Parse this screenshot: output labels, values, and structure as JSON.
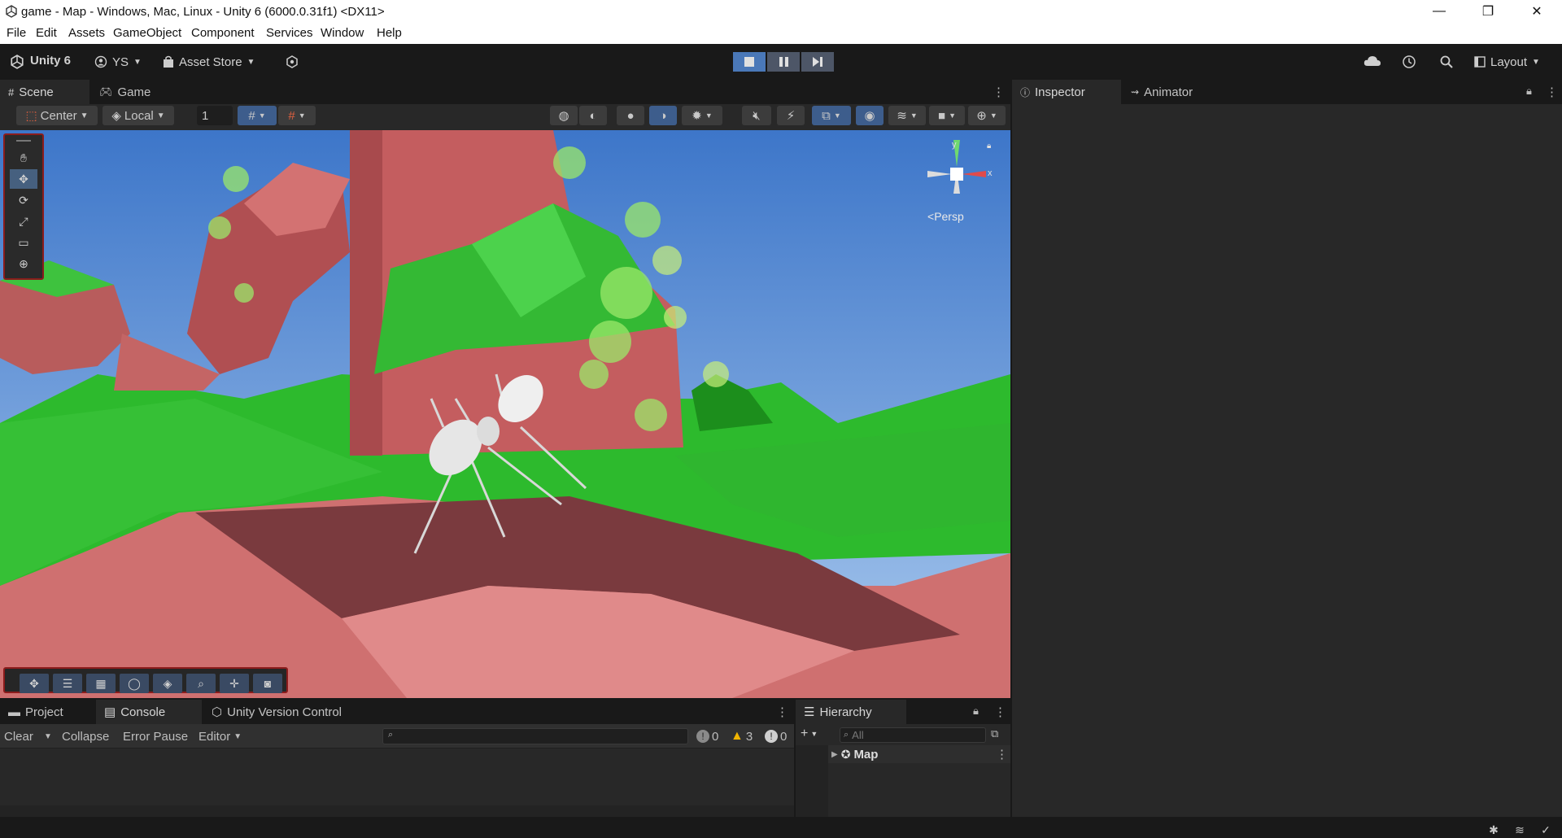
{
  "window": {
    "title": "game - Map - Windows, Mac, Linux - Unity 6 (6000.0.31f1) <DX11>",
    "controls": {
      "minimize": "—",
      "maximize": "❐",
      "close": "✕"
    }
  },
  "menu": [
    "File",
    "Edit",
    "Assets",
    "GameObject",
    "Component",
    "Services",
    "Window",
    "Help"
  ],
  "toolbar": {
    "product": "Unity 6",
    "account": "YS",
    "asset_store": "Asset Store",
    "layout": "Layout"
  },
  "scene_panel": {
    "tabs": [
      "Scene",
      "Game"
    ],
    "pivot_mode": "Center",
    "pivot_space": "Local",
    "grid_size": "1",
    "gizmo_view": "Persp",
    "axis_y": "y",
    "axis_x": "x"
  },
  "inspector_panel": {
    "tabs": [
      "Inspector",
      "Animator"
    ]
  },
  "console_panel": {
    "tabs": [
      "Project",
      "Console",
      "Unity Version Control"
    ],
    "buttons": {
      "clear": "Clear",
      "collapse": "Collapse",
      "error_pause": "Error Pause",
      "editor": "Editor"
    },
    "counts": {
      "info": "0",
      "warnings": "3",
      "errors": "0"
    }
  },
  "hierarchy_panel": {
    "tab": "Hierarchy",
    "search_placeholder": "All",
    "root": "Map"
  },
  "colors": {
    "accent_blue": "#4a78b8",
    "panel_bg": "#282828",
    "editor_bg": "#191919"
  }
}
